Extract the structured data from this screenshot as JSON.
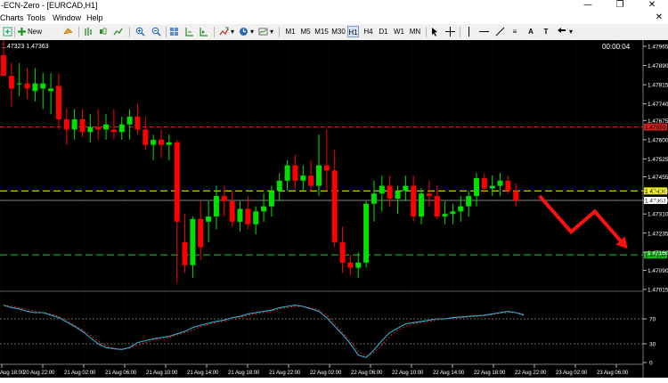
{
  "window": {
    "title": "-ECN-Zero - [EURCAD,H1]",
    "controls": [
      "—",
      "❐",
      "✕"
    ]
  },
  "menu": {
    "items": [
      "Charts",
      "Tools",
      "Window",
      "Help"
    ],
    "close_glyph": "✕"
  },
  "toolbar": {
    "new_order_label": "New Order",
    "timeframes": [
      "M1",
      "M5",
      "M15",
      "M30",
      "H1",
      "H4",
      "D1",
      "W1",
      "MN"
    ],
    "active_timeframe": "H1",
    "line_tool_label": "≡",
    "text_tool_label": "A",
    "label_tool_label": "T"
  },
  "chart": {
    "header_text": "1.47323 1.47363",
    "countdown": "00:00:04",
    "price_axis": [
      "1.47965",
      "1.47890",
      "1.47815",
      "1.47740",
      "1.47675",
      "1.47600",
      "1.47525",
      "1.47455",
      "1.47400",
      "1.47363",
      "1.47310",
      "1.47235",
      "1.47160",
      "1.47090",
      "1.47015"
    ],
    "highlighted_levels": [
      {
        "price": "1.47650",
        "color": "#d02020"
      },
      {
        "price": "1.47400",
        "color": "#e8e800"
      },
      {
        "price": "1.47363",
        "color": "#ffffff"
      },
      {
        "price": "1.47150",
        "color": "#18c018"
      }
    ],
    "colors": {
      "bull": "#00e000",
      "bear": "#ff0000",
      "grid": "#3a3a3a",
      "resistance_line": "#d02020",
      "support_line": "#18b018",
      "mid_line": "#c8c800",
      "current_price_line": "#b0b0b0",
      "arrow": "#ff1010"
    },
    "candles": [
      [
        1.4793,
        1.4801,
        1.4785,
        1.4785
      ],
      [
        1.4785,
        1.479,
        1.4773,
        1.478
      ],
      [
        1.4782,
        1.479,
        1.4777,
        1.4782
      ],
      [
        1.4782,
        1.4788,
        1.4776,
        1.478
      ],
      [
        1.4779,
        1.4788,
        1.4775,
        1.4782
      ],
      [
        1.478,
        1.4786,
        1.4772,
        1.4782
      ],
      [
        1.4779,
        1.4786,
        1.477,
        1.478
      ],
      [
        1.4781,
        1.4786,
        1.4764,
        1.4768
      ],
      [
        1.4768,
        1.4772,
        1.4758,
        1.4764
      ],
      [
        1.4764,
        1.4772,
        1.476,
        1.4768
      ],
      [
        1.4768,
        1.4772,
        1.4761,
        1.4763
      ],
      [
        1.4763,
        1.477,
        1.4759,
        1.4765
      ],
      [
        1.4765,
        1.4772,
        1.476,
        1.4764
      ],
      [
        1.4764,
        1.477,
        1.476,
        1.4766
      ],
      [
        1.4764,
        1.4772,
        1.476,
        1.4763
      ],
      [
        1.4763,
        1.4769,
        1.476,
        1.4766
      ],
      [
        1.4766,
        1.4772,
        1.476,
        1.4769
      ],
      [
        1.4769,
        1.4774,
        1.4762,
        1.4764
      ],
      [
        1.4764,
        1.4769,
        1.4756,
        1.4758
      ],
      [
        1.4758,
        1.4762,
        1.4752,
        1.476
      ],
      [
        1.476,
        1.4764,
        1.4753,
        1.4758
      ],
      [
        1.4758,
        1.4762,
        1.4752,
        1.4759
      ],
      [
        1.4759,
        1.476,
        1.4704,
        1.4728
      ],
      [
        1.472,
        1.4731,
        1.4708,
        1.4711
      ],
      [
        1.4711,
        1.473,
        1.4706,
        1.4729
      ],
      [
        1.4729,
        1.4736,
        1.4713,
        1.4718
      ],
      [
        1.4728,
        1.4736,
        1.472,
        1.473
      ],
      [
        1.473,
        1.4742,
        1.4725,
        1.4738
      ],
      [
        1.4738,
        1.4742,
        1.473,
        1.4736
      ],
      [
        1.4736,
        1.474,
        1.4726,
        1.4728
      ],
      [
        1.4728,
        1.4736,
        1.4724,
        1.4733
      ],
      [
        1.4733,
        1.4738,
        1.4725,
        1.4727
      ],
      [
        1.4727,
        1.4734,
        1.4723,
        1.4732
      ],
      [
        1.4732,
        1.4739,
        1.4728,
        1.4734
      ],
      [
        1.4734,
        1.4742,
        1.473,
        1.474
      ],
      [
        1.474,
        1.4747,
        1.4736,
        1.4744
      ],
      [
        1.4744,
        1.4752,
        1.474,
        1.475
      ],
      [
        1.475,
        1.4754,
        1.4741,
        1.4744
      ],
      [
        1.4744,
        1.475,
        1.474,
        1.4746
      ],
      [
        1.4746,
        1.4752,
        1.474,
        1.4742
      ],
      [
        1.4742,
        1.4762,
        1.4738,
        1.475
      ],
      [
        1.475,
        1.4764,
        1.474,
        1.4748
      ],
      [
        1.4748,
        1.4756,
        1.4718,
        1.472
      ],
      [
        1.472,
        1.4726,
        1.4708,
        1.4712
      ],
      [
        1.4712,
        1.4715,
        1.4707,
        1.471
      ],
      [
        1.471,
        1.4716,
        1.4706,
        1.4712
      ],
      [
        1.4712,
        1.4736,
        1.471,
        1.4735
      ],
      [
        1.4735,
        1.4744,
        1.4728,
        1.4739
      ],
      [
        1.4739,
        1.4746,
        1.4732,
        1.4742
      ],
      [
        1.4742,
        1.4746,
        1.4734,
        1.4737
      ],
      [
        1.4737,
        1.4742,
        1.4731,
        1.474
      ],
      [
        1.474,
        1.4746,
        1.4736,
        1.4742
      ],
      [
        1.4742,
        1.4746,
        1.4728,
        1.473
      ],
      [
        1.473,
        1.4741,
        1.4727,
        1.4739
      ],
      [
        1.4739,
        1.4744,
        1.4734,
        1.4738
      ],
      [
        1.4738,
        1.4742,
        1.4729,
        1.473
      ],
      [
        1.473,
        1.4736,
        1.4727,
        1.4731
      ],
      [
        1.4731,
        1.4735,
        1.4727,
        1.4732
      ],
      [
        1.4732,
        1.4738,
        1.4728,
        1.4734
      ],
      [
        1.4734,
        1.474,
        1.473,
        1.4738
      ],
      [
        1.4738,
        1.4747,
        1.4734,
        1.4745
      ],
      [
        1.4745,
        1.4747,
        1.4739,
        1.4741
      ],
      [
        1.4741,
        1.4746,
        1.4738,
        1.4742
      ],
      [
        1.4742,
        1.4747,
        1.4738,
        1.4744
      ],
      [
        1.4744,
        1.4746,
        1.4739,
        1.474
      ],
      [
        1.474,
        1.4743,
        1.4734,
        1.47363
      ]
    ],
    "forecast_arrow": {
      "points": [
        [
          68,
          1.4738
        ],
        [
          72,
          1.4724
        ],
        [
          75,
          1.4732
        ],
        [
          79,
          1.4718
        ]
      ]
    },
    "indicator": {
      "levels": [
        "70",
        "30",
        "0"
      ],
      "main": [
        92,
        88,
        86,
        82,
        80,
        80,
        76,
        72,
        65,
        58,
        50,
        40,
        30,
        24,
        22,
        21,
        24,
        32,
        35,
        38,
        40,
        42,
        46,
        50,
        56,
        60,
        63,
        66,
        68,
        72,
        74,
        78,
        80,
        82,
        84,
        88,
        90,
        92,
        90,
        86,
        82,
        72,
        58,
        45,
        30,
        12,
        8,
        20,
        35,
        48,
        55,
        62,
        64,
        66,
        68,
        70,
        70,
        72,
        73,
        74,
        75,
        76,
        78,
        80,
        82,
        80,
        76
      ],
      "signal": [
        92,
        90,
        88,
        85,
        82,
        80,
        78,
        74,
        68,
        60,
        52,
        44,
        34,
        27,
        23,
        21,
        23,
        28,
        32,
        36,
        38,
        40,
        44,
        48,
        52,
        58,
        61,
        64,
        66,
        70,
        72,
        76,
        78,
        80,
        82,
        86,
        88,
        90,
        90,
        88,
        84,
        76,
        62,
        48,
        34,
        18,
        10,
        16,
        28,
        42,
        52,
        58,
        62,
        64,
        66,
        68,
        70,
        71,
        72,
        73,
        74,
        75,
        77,
        79,
        80,
        80,
        78
      ]
    },
    "time_axis": [
      "Aug 18:00",
      "20 Aug 22:00",
      "21 Aug 02:00",
      "21 Aug 06:00",
      "21 Aug 10:00",
      "21 Aug 14:00",
      "21 Aug 18:00",
      "21 Aug 22:00",
      "22 Aug 02:00",
      "22 Aug 06:00",
      "22 Aug 10:00",
      "22 Aug 14:00",
      "22 Aug 18:00",
      "22 Aug 22:00",
      "23 Aug 02:00",
      "23 Aug 06:00"
    ]
  }
}
